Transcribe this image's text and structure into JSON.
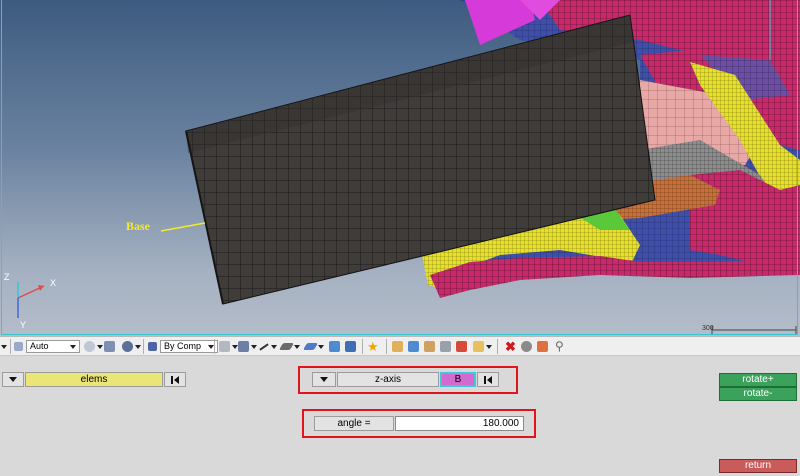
{
  "viewport": {
    "annotation_label": "Base",
    "triad": {
      "z": "Z",
      "x": "X",
      "y": "Y"
    },
    "scale_label": "300"
  },
  "toolbar": {
    "display_mode": "Auto",
    "color_mode": "By Comp",
    "icons": [
      "cube-icon",
      "shaded-icon",
      "wire-icon",
      "component-icon",
      "sphere-icon",
      "cube-mesh-icon",
      "cube-solid-icon",
      "line-icon",
      "plane-icon",
      "view-icon",
      "vector-icon",
      "monitor-icon",
      "star-icon",
      "group-icon",
      "load-icon",
      "part-icon",
      "tag-icon",
      "arrow-icon",
      "delete-icon",
      "mask-icon",
      "unmask-icon",
      "pin-icon"
    ],
    "accent": "#f0a500"
  },
  "panel": {
    "entity_selector": {
      "label": "elems",
      "color": "#e9e677"
    },
    "axis_selector": {
      "axis_label": "z-axis",
      "base_button": "B",
      "base_color": "#d36ad0"
    },
    "angle": {
      "label": "angle =",
      "value": "180.000"
    },
    "rotate_plus": "rotate+",
    "rotate_minus": "rotate-",
    "return_label": "return",
    "green": "#3aa25a",
    "return_color": "#c95b5b",
    "highlight_color": "#e0141c"
  }
}
